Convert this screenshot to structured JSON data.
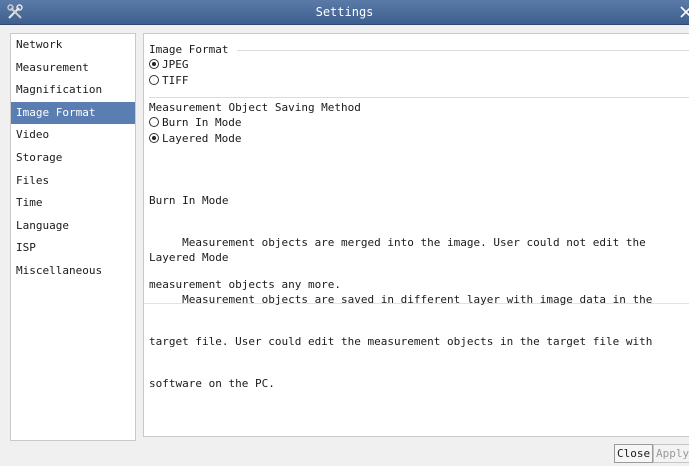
{
  "window": {
    "title": "Settings"
  },
  "sidebar": {
    "items": [
      {
        "label": "Network"
      },
      {
        "label": "Measurement"
      },
      {
        "label": "Magnification"
      },
      {
        "label": "Image Format"
      },
      {
        "label": "Video"
      },
      {
        "label": "Storage"
      },
      {
        "label": "Files"
      },
      {
        "label": "Time"
      },
      {
        "label": "Language"
      },
      {
        "label": "ISP"
      },
      {
        "label": "Miscellaneous"
      }
    ],
    "selected": "Image Format"
  },
  "image_format": {
    "header": "Image Format",
    "options": [
      {
        "label": "JPEG",
        "selected": true
      },
      {
        "label": "TIFF",
        "selected": false
      }
    ]
  },
  "saving_method": {
    "header": "Measurement Object Saving Method",
    "options": [
      {
        "label": "Burn In Mode",
        "selected": false
      },
      {
        "label": "Layered Mode",
        "selected": true
      }
    ]
  },
  "descriptions": {
    "burn_in": {
      "title": "Burn In Mode",
      "line1": "     Measurement objects are merged into the image. User could not edit the",
      "line2": "measurement objects any more."
    },
    "layered": {
      "title": "Layered Mode",
      "line1": "     Measurement objects are saved in different layer with image data in the",
      "line2": "target file. User could edit the measurement objects in the target file with",
      "line3": "software on the PC."
    }
  },
  "buttons": {
    "close": "Close",
    "apply": "Apply"
  },
  "colors": {
    "titlebar": "#4a6a9a",
    "selection": "#5b7eb2"
  },
  "icons": {
    "app": "wrench-icon",
    "close": "close-icon"
  }
}
